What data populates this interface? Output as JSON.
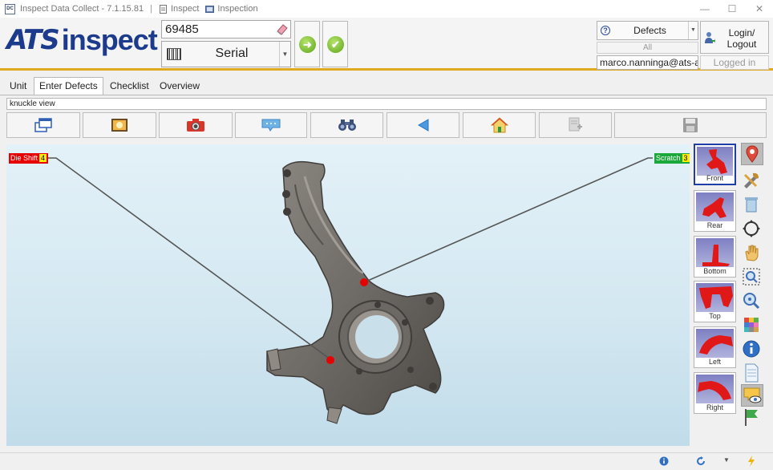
{
  "titlebar": {
    "app_title": "Inspect Data Collect - 7.1.15.81",
    "crumb1": "Inspect",
    "crumb2": "Inspection",
    "app_icon_text": "DC"
  },
  "header": {
    "logo_ats": "ATS",
    "logo_inspect": "inspect",
    "serial_value": "69485",
    "serial_type": "Serial",
    "defects_select": "Defects",
    "all_label": "All",
    "user_email": "marco.nanninga@ats-ac",
    "login_label_line1": "Login/",
    "login_label_line2": "Logout",
    "logged_in_label": "Logged in"
  },
  "tabs": [
    {
      "label": "Unit"
    },
    {
      "label": "Enter Defects",
      "active": true
    },
    {
      "label": "Checklist"
    },
    {
      "label": "Overview"
    }
  ],
  "view_name": "knuckle view",
  "toolbar": [
    {
      "icon": "window-view-icon"
    },
    {
      "icon": "picture-icon"
    },
    {
      "icon": "camera-icon"
    },
    {
      "icon": "comment-icon"
    },
    {
      "icon": "binoculars-icon"
    },
    {
      "icon": "back-arrow-icon"
    },
    {
      "icon": "home-icon"
    },
    {
      "icon": "add-page-icon",
      "disabled": true
    },
    {
      "icon": "save-icon",
      "disabled": true
    }
  ],
  "defects": [
    {
      "label": "Die Shift",
      "count": "4",
      "color": "#e60000"
    },
    {
      "label": "Scratch",
      "count": "3",
      "color": "#1aa83a"
    }
  ],
  "views": [
    {
      "label": "Front",
      "selected": true
    },
    {
      "label": "Rear"
    },
    {
      "label": "Bottom"
    },
    {
      "label": "Top"
    },
    {
      "label": "Left"
    },
    {
      "label": "Right"
    }
  ],
  "tools": [
    "map-marker-icon",
    "tools-icon",
    "trash-icon",
    "rotate-icon",
    "pan-hand-icon",
    "zoom-box-icon",
    "zoom-icon",
    "color-palette-icon",
    "info-icon",
    "document-icon",
    "eye-comment-icon",
    "flag-icon"
  ],
  "colors": {
    "accent_bar": "#e0a91e",
    "brand": "#1c3b8c",
    "selection": "#1f3ea8"
  }
}
